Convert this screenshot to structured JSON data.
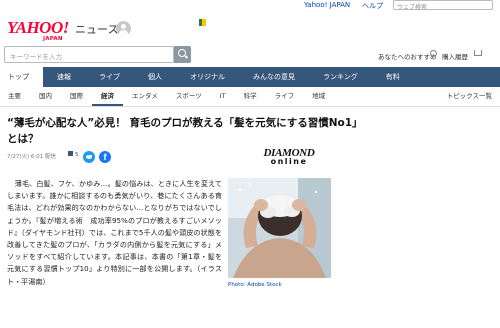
{
  "util": {
    "yahoo_link": "Yahoo! JAPAN",
    "help_link": "ヘルプ",
    "web_search_placeholder": "ウェブ検索"
  },
  "header": {
    "logo": "YAHOO!",
    "logo_sub": "JAPAN",
    "service": "ニュース"
  },
  "search": {
    "placeholder": "キーワードを入力",
    "recommend": "あなたへのおすすめ",
    "purchase": "購入履歴"
  },
  "nav": {
    "main": [
      "トップ",
      "速報",
      "ライブ",
      "個人",
      "オリジナル",
      "みんなの意見",
      "ランキング",
      "有料"
    ],
    "sub": [
      "主要",
      "国内",
      "国際",
      "経済",
      "エンタメ",
      "スポーツ",
      "IT",
      "科学",
      "ライフ",
      "地域"
    ],
    "sub_active": "経済",
    "topics": "トピックス一覧"
  },
  "article": {
    "title": "“薄毛が心配な人”必見！ 育毛のプロが教える「髪を元気にする習慣No1」とは？",
    "meta": "7/27(火) 6:01 配信",
    "comments": "5",
    "publisher_line1": "DIAMOND",
    "publisher_line2": "online",
    "body": "薄毛、白髪、フケ、かゆみ…。髪の悩みは、ときに人生を変えてしまいます。誰かに相談するのも勇気がいり、巷にたくさんある育毛法は、どれが効果的なのかわからない…となりがちではないでしょうか。『髪が増える術　成功率95%のプロが教えるすごいメソッド』（ダイヤモンド社刊）では、これまで5千人の髪や頭皮の状態を改善してきた髪のプロが、「カラダの内側から髪を元気にする」メソッドをすべて紹介しています。本記事は、本書の「第1章・髪を元気にする習慣トップ10」より特別に一部を公開します。（イラスト・平湯南）",
    "photo_caption": "Photo: Adobe Stock"
  },
  "colors": {
    "nav_bg": "#36577c",
    "logo_red": "#ff0033",
    "link_blue": "#0645ad"
  }
}
